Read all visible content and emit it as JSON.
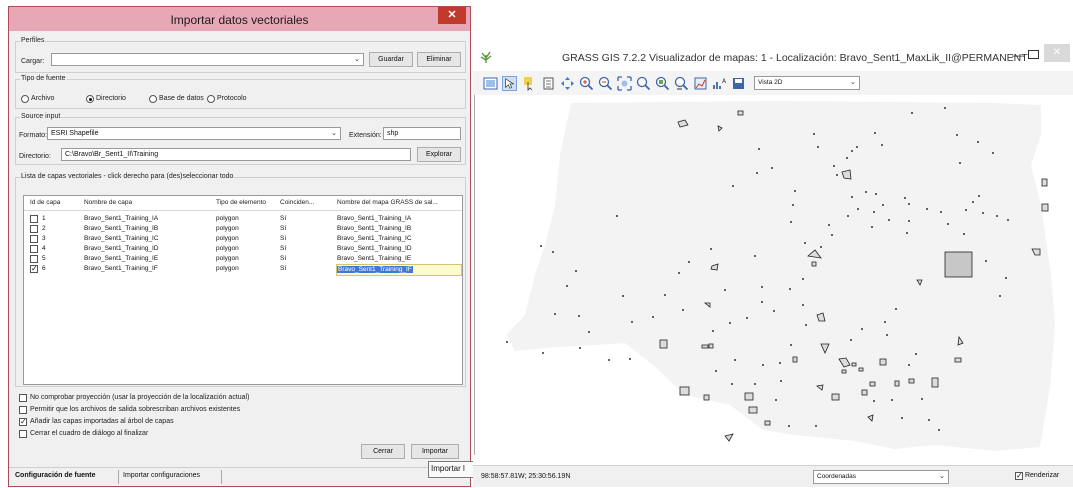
{
  "dialog": {
    "title": "Importar datos vectoriales",
    "close_glyph": "✕",
    "profiles": {
      "group_label": "Perfiles",
      "load_label": "Cargar:",
      "load_value": "",
      "save_button": "Guardar",
      "delete_button": "Eliminar"
    },
    "source_type": {
      "group_label": "Tipo de fuente",
      "options": [
        "Archivo",
        "Directorio",
        "Base de datos",
        "Protocolo"
      ],
      "selected": "Directorio"
    },
    "source_input": {
      "group_label": "Source input",
      "format_label": "Formato:",
      "format_value": "ESRI Shapefile",
      "extension_label": "Extensión:",
      "extension_value": "shp",
      "directory_label": "Directorio:",
      "directory_value": "C:\\Bravo\\Br_Sent1_II\\Training",
      "browse_button": "Explorar"
    },
    "layers": {
      "group_label": "Lista de capas vectoriales - click derecho para (des)seleccionar todo",
      "columns": [
        "Id de capa",
        "Nombre de capa",
        "Tipo de elemento",
        "Coinciden...",
        "Nombre del mapa GRASS de sal..."
      ],
      "rows": [
        {
          "id": "1",
          "name": "Bravo_Sent1_Training_IA",
          "type": "polygon",
          "match": "Sí",
          "output": "Bravo_Sent1_Training_IA",
          "checked": false
        },
        {
          "id": "2",
          "name": "Bravo_Sent1_Training_IB",
          "type": "polygon",
          "match": "Sí",
          "output": "Bravo_Sent1_Training_IB",
          "checked": false
        },
        {
          "id": "3",
          "name": "Bravo_Sent1_Training_IC",
          "type": "polygon",
          "match": "Sí",
          "output": "Bravo_Sent1_Training_IC",
          "checked": false
        },
        {
          "id": "4",
          "name": "Bravo_Sent1_Training_ID",
          "type": "polygon",
          "match": "Sí",
          "output": "Bravo_Sent1_Training_ID",
          "checked": false
        },
        {
          "id": "5",
          "name": "Bravo_Sent1_Training_IE",
          "type": "polygon",
          "match": "Sí",
          "output": "Bravo_Sent1_Training_IE",
          "checked": false
        },
        {
          "id": "6",
          "name": "Bravo_Sent1_Training_IF",
          "type": "polygon",
          "match": "Sí",
          "output": "Bravo_Sent1_Training_IF",
          "checked": true
        }
      ]
    },
    "options": [
      {
        "label": "No comprobar proyección (usar la proyección de la localización actual)",
        "checked": false
      },
      {
        "label": "Permitir que los archivos de salida sobrescriban archivos existentes",
        "checked": false
      },
      {
        "label": "Añadir las capas importadas al árbol de capas",
        "checked": true
      },
      {
        "label": "Cerrar el cuadro de diálogo al finalizar",
        "checked": false
      }
    ],
    "close_button": "Cerrar",
    "import_button": "Importar",
    "tabs": [
      "Configuración de fuente",
      "Importar configuraciones"
    ],
    "active_tab": "Configuración de fuente",
    "tooltip": "Importar l"
  },
  "map_window": {
    "title": "GRASS GIS 7.2.2 Visualizador de mapas: 1 - Localización: Bravo_Sent1_MaxLik_II@PERMANENT",
    "minimize_glyph": "—",
    "close_glyph": "✕",
    "toolbar_icons": [
      "display-map-icon",
      "pointer-icon",
      "query-icon",
      "add-layer-icon",
      "pan-icon",
      "zoom-in-icon",
      "zoom-out-icon",
      "zoom-extent-icon",
      "zoom-back-icon",
      "zoom-region-icon",
      "zoom-menu-icon",
      "analyze-icon",
      "decorations-icon",
      "save-display-icon"
    ],
    "view_select": "Vista 2D",
    "status": {
      "coordinates": "98:58:57.81W; 25:30:56.19N",
      "mode_select": "Coordenadas",
      "render_label": "Renderizar",
      "render_checked": true
    }
  },
  "colors": {
    "dialog_title_bg": "#e8a7b4",
    "close_red": "#c0392b",
    "raster_fill": "#f3f3f3",
    "selection_blue": "#3a7bd5",
    "selection_yellow": "#fffacd"
  }
}
